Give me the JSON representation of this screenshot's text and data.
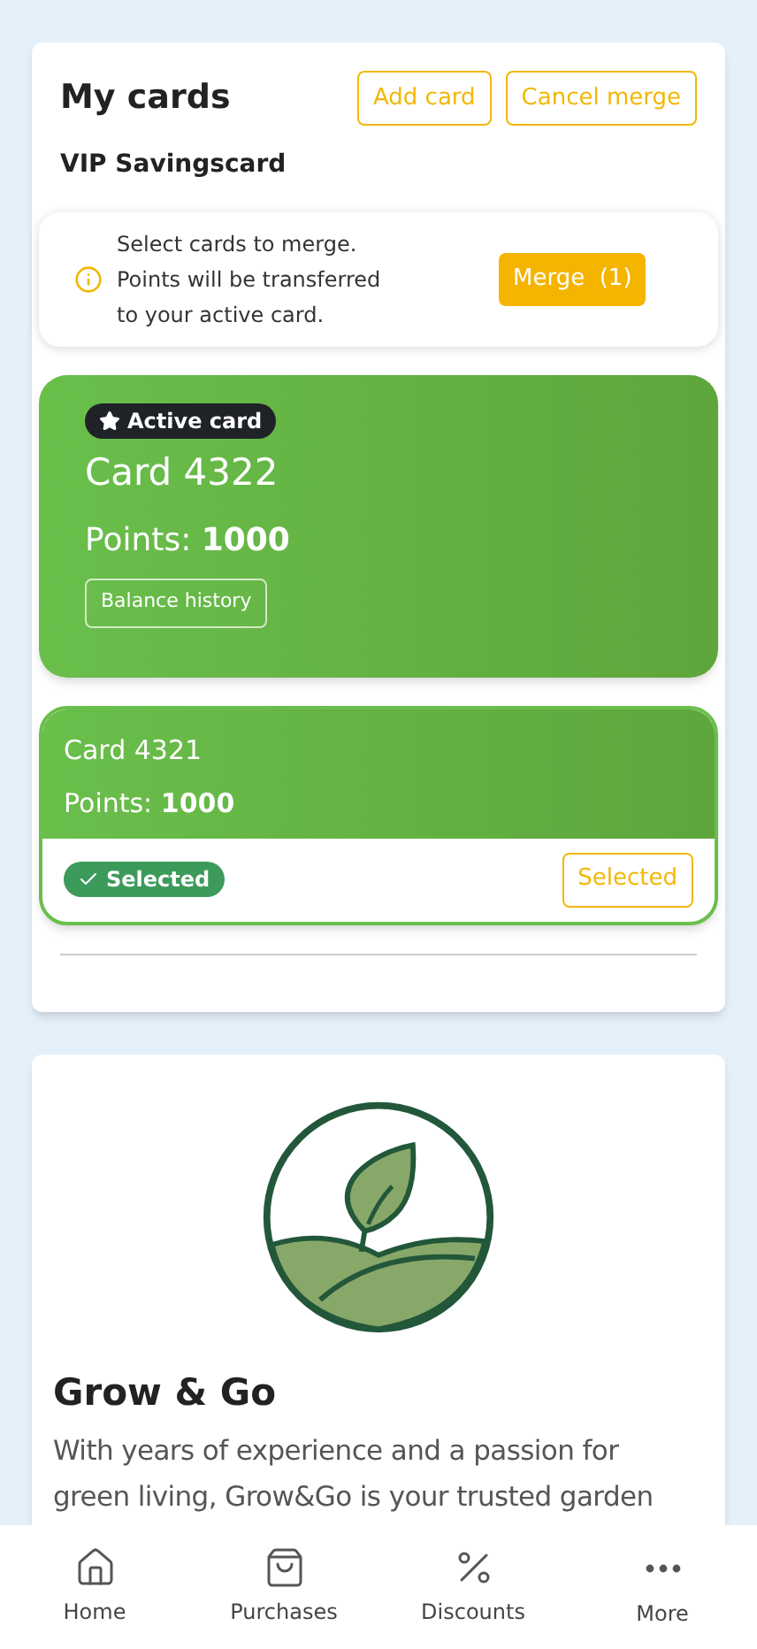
{
  "header": {
    "title": "My cards",
    "buttons": [
      "Add card",
      "Cancel merge"
    ]
  },
  "program": "VIP Savingscard",
  "merge_notice": {
    "lines": [
      "Select cards to merge.",
      "Points will be transferred",
      "to your active card."
    ],
    "button": "Merge  (1)"
  },
  "cards": [
    {
      "name": "Card 4322",
      "points_label": "Points: ",
      "points": "1000",
      "active": true,
      "active_badge": "Active card",
      "history_button": "Balance history"
    },
    {
      "name": "Card 4321",
      "points_label": "Points: ",
      "points": "1000",
      "active": false,
      "selected": true,
      "selected_badge": "Selected",
      "select_button": "Selected"
    }
  ],
  "store": {
    "title": "Grow & Go",
    "description": "With years of experience and a passion for green living, Grow&Go is your trusted garden"
  },
  "nav": [
    {
      "label": "Home",
      "kind": "home"
    },
    {
      "label": "Purchases",
      "kind": "bag"
    },
    {
      "label": "Discounts",
      "kind": "percent"
    },
    {
      "label": "More",
      "kind": "more"
    }
  ]
}
